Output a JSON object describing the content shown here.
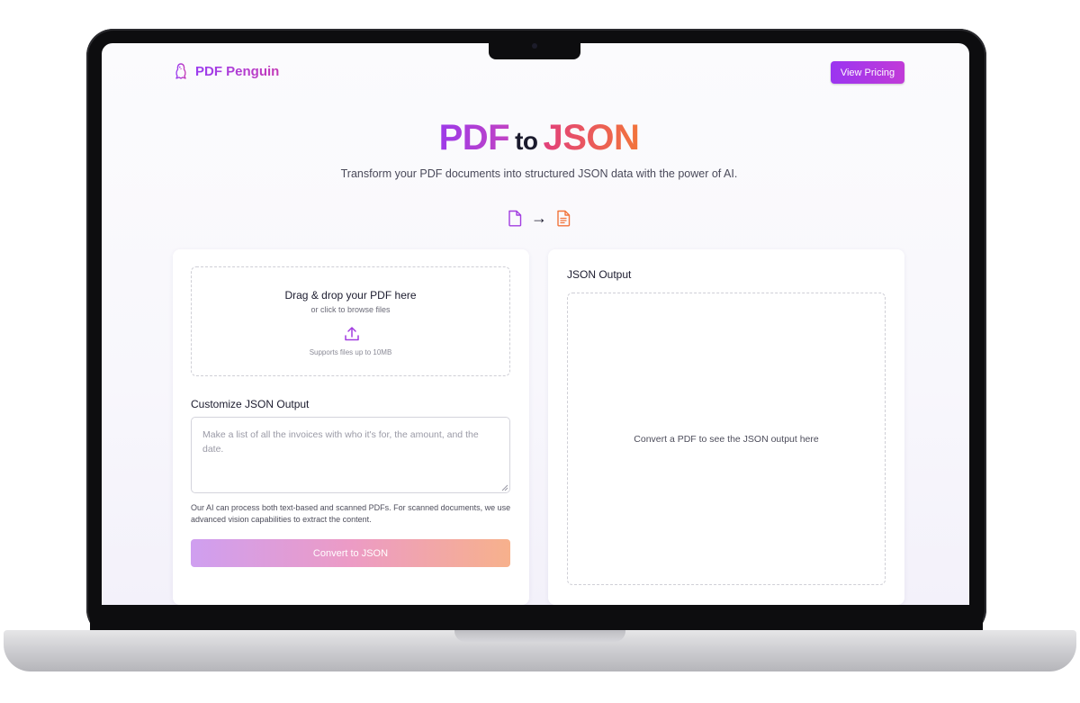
{
  "header": {
    "brand_name": "PDF Penguin",
    "pricing_button": "View Pricing"
  },
  "hero": {
    "title_part1": "PDF",
    "title_part2": "to",
    "title_part3": "JSON",
    "subtitle": "Transform your PDF documents into structured JSON data with the power of AI.",
    "arrow": "→"
  },
  "upload": {
    "title": "Drag & drop your PDF here",
    "subtitle": "or click to browse files",
    "hint": "Supports files up to 10MB"
  },
  "customize": {
    "label": "Customize JSON Output",
    "placeholder": "Make a list of all the invoices with who it's for, the amount, and the date.",
    "info": "Our AI can process both text-based and scanned PDFs. For scanned documents, we use advanced vision capabilities to extract the content.",
    "convert_button": "Convert to JSON"
  },
  "output": {
    "label": "JSON Output",
    "empty_message": "Convert a PDF to see the JSON output here"
  },
  "colors": {
    "brand_purple": "#9b35f0",
    "accent_pink": "#e2407b",
    "accent_orange": "#f2743b",
    "laptop_bezel": "#0d0d0f"
  },
  "icons": {
    "brand": "penguin-icon",
    "source_file": "file-icon",
    "target_file": "file-text-icon",
    "upload": "upload-icon"
  }
}
